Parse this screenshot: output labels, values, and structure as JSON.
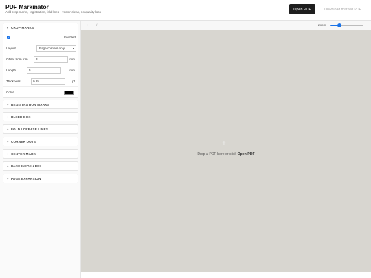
{
  "header": {
    "title": "PDF Markinator",
    "subtitle": "Add crop marks, registration, fold lines · vector-clean, no quality loss",
    "open_label": "Open PDF",
    "download_label": "Download marked PDF"
  },
  "crop": {
    "title": "CROP MARKS",
    "enabled_label": "Enabled",
    "enabled": true,
    "layout_label": "Layout",
    "layout_value": "Page corners only",
    "offset_label": "Offset from trim",
    "offset_value": "3",
    "offset_unit": "mm",
    "length_label": "Length",
    "length_value": "5",
    "length_unit": "mm",
    "thickness_label": "Thickness",
    "thickness_value": "0.25",
    "thickness_unit": "pt",
    "color_label": "Color",
    "color_value": "#000000"
  },
  "sections": [
    {
      "title": "REGISTRATION MARKS"
    },
    {
      "title": "BLEED BOX"
    },
    {
      "title": "FOLD / CREASE LINES"
    },
    {
      "title": "CORNER DOTS"
    },
    {
      "title": "CENTER MARK"
    },
    {
      "title": "PAGE INFO LABEL"
    },
    {
      "title": "PAGE EXPANSION"
    }
  ],
  "viewer": {
    "prev": "‹",
    "page_indicator": "— / —",
    "next": "›",
    "zoom_label": "Zoom",
    "zoom_level": 0.25,
    "drop_text": "Drop a PDF here or click ",
    "drop_link": "Open PDF"
  },
  "colors": {
    "accent": "#1a73e8",
    "dark_button": "#1e1e1e",
    "canvas": "#d8d6d0"
  }
}
